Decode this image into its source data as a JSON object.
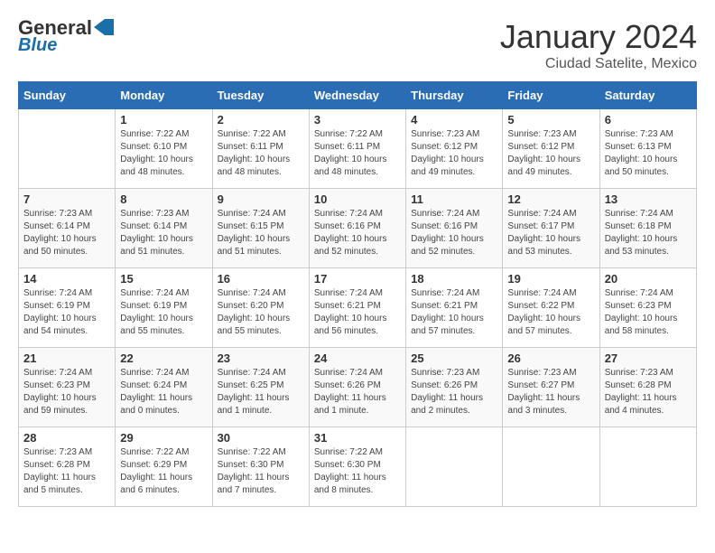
{
  "header": {
    "logo_line1": "General",
    "logo_line2": "Blue",
    "month_year": "January 2024",
    "location": "Ciudad Satelite, Mexico"
  },
  "days_of_week": [
    "Sunday",
    "Monday",
    "Tuesday",
    "Wednesday",
    "Thursday",
    "Friday",
    "Saturday"
  ],
  "weeks": [
    [
      {
        "day": "",
        "info": ""
      },
      {
        "day": "1",
        "info": "Sunrise: 7:22 AM\nSunset: 6:10 PM\nDaylight: 10 hours\nand 48 minutes."
      },
      {
        "day": "2",
        "info": "Sunrise: 7:22 AM\nSunset: 6:11 PM\nDaylight: 10 hours\nand 48 minutes."
      },
      {
        "day": "3",
        "info": "Sunrise: 7:22 AM\nSunset: 6:11 PM\nDaylight: 10 hours\nand 48 minutes."
      },
      {
        "day": "4",
        "info": "Sunrise: 7:23 AM\nSunset: 6:12 PM\nDaylight: 10 hours\nand 49 minutes."
      },
      {
        "day": "5",
        "info": "Sunrise: 7:23 AM\nSunset: 6:12 PM\nDaylight: 10 hours\nand 49 minutes."
      },
      {
        "day": "6",
        "info": "Sunrise: 7:23 AM\nSunset: 6:13 PM\nDaylight: 10 hours\nand 50 minutes."
      }
    ],
    [
      {
        "day": "7",
        "info": "Sunrise: 7:23 AM\nSunset: 6:14 PM\nDaylight: 10 hours\nand 50 minutes."
      },
      {
        "day": "8",
        "info": "Sunrise: 7:23 AM\nSunset: 6:14 PM\nDaylight: 10 hours\nand 51 minutes."
      },
      {
        "day": "9",
        "info": "Sunrise: 7:24 AM\nSunset: 6:15 PM\nDaylight: 10 hours\nand 51 minutes."
      },
      {
        "day": "10",
        "info": "Sunrise: 7:24 AM\nSunset: 6:16 PM\nDaylight: 10 hours\nand 52 minutes."
      },
      {
        "day": "11",
        "info": "Sunrise: 7:24 AM\nSunset: 6:16 PM\nDaylight: 10 hours\nand 52 minutes."
      },
      {
        "day": "12",
        "info": "Sunrise: 7:24 AM\nSunset: 6:17 PM\nDaylight: 10 hours\nand 53 minutes."
      },
      {
        "day": "13",
        "info": "Sunrise: 7:24 AM\nSunset: 6:18 PM\nDaylight: 10 hours\nand 53 minutes."
      }
    ],
    [
      {
        "day": "14",
        "info": "Sunrise: 7:24 AM\nSunset: 6:19 PM\nDaylight: 10 hours\nand 54 minutes."
      },
      {
        "day": "15",
        "info": "Sunrise: 7:24 AM\nSunset: 6:19 PM\nDaylight: 10 hours\nand 55 minutes."
      },
      {
        "day": "16",
        "info": "Sunrise: 7:24 AM\nSunset: 6:20 PM\nDaylight: 10 hours\nand 55 minutes."
      },
      {
        "day": "17",
        "info": "Sunrise: 7:24 AM\nSunset: 6:21 PM\nDaylight: 10 hours\nand 56 minutes."
      },
      {
        "day": "18",
        "info": "Sunrise: 7:24 AM\nSunset: 6:21 PM\nDaylight: 10 hours\nand 57 minutes."
      },
      {
        "day": "19",
        "info": "Sunrise: 7:24 AM\nSunset: 6:22 PM\nDaylight: 10 hours\nand 57 minutes."
      },
      {
        "day": "20",
        "info": "Sunrise: 7:24 AM\nSunset: 6:23 PM\nDaylight: 10 hours\nand 58 minutes."
      }
    ],
    [
      {
        "day": "21",
        "info": "Sunrise: 7:24 AM\nSunset: 6:23 PM\nDaylight: 10 hours\nand 59 minutes."
      },
      {
        "day": "22",
        "info": "Sunrise: 7:24 AM\nSunset: 6:24 PM\nDaylight: 11 hours\nand 0 minutes."
      },
      {
        "day": "23",
        "info": "Sunrise: 7:24 AM\nSunset: 6:25 PM\nDaylight: 11 hours\nand 1 minute."
      },
      {
        "day": "24",
        "info": "Sunrise: 7:24 AM\nSunset: 6:26 PM\nDaylight: 11 hours\nand 1 minute."
      },
      {
        "day": "25",
        "info": "Sunrise: 7:23 AM\nSunset: 6:26 PM\nDaylight: 11 hours\nand 2 minutes."
      },
      {
        "day": "26",
        "info": "Sunrise: 7:23 AM\nSunset: 6:27 PM\nDaylight: 11 hours\nand 3 minutes."
      },
      {
        "day": "27",
        "info": "Sunrise: 7:23 AM\nSunset: 6:28 PM\nDaylight: 11 hours\nand 4 minutes."
      }
    ],
    [
      {
        "day": "28",
        "info": "Sunrise: 7:23 AM\nSunset: 6:28 PM\nDaylight: 11 hours\nand 5 minutes."
      },
      {
        "day": "29",
        "info": "Sunrise: 7:22 AM\nSunset: 6:29 PM\nDaylight: 11 hours\nand 6 minutes."
      },
      {
        "day": "30",
        "info": "Sunrise: 7:22 AM\nSunset: 6:30 PM\nDaylight: 11 hours\nand 7 minutes."
      },
      {
        "day": "31",
        "info": "Sunrise: 7:22 AM\nSunset: 6:30 PM\nDaylight: 11 hours\nand 8 minutes."
      },
      {
        "day": "",
        "info": ""
      },
      {
        "day": "",
        "info": ""
      },
      {
        "day": "",
        "info": ""
      }
    ]
  ]
}
